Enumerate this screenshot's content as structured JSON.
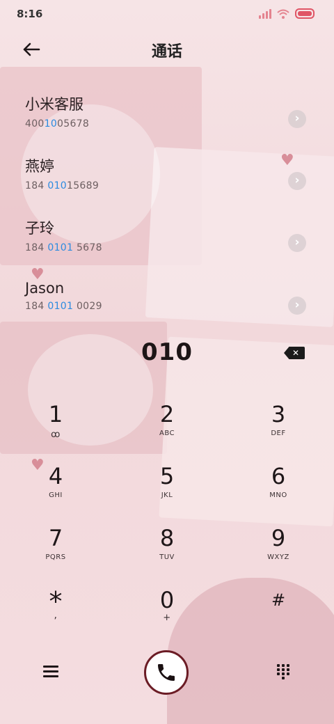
{
  "status_bar": {
    "time": "8:16"
  },
  "header": {
    "title": "通话"
  },
  "contacts": [
    {
      "name": "小米客服",
      "number_pre": "400",
      "number_hl": "10",
      "number_post": "05678"
    },
    {
      "name": "燕婷",
      "number_pre": "184 ",
      "number_hl": "010",
      "number_post": "15689"
    },
    {
      "name": "子玲",
      "number_pre": "184 ",
      "number_hl": "0101",
      "number_post": " 5678"
    },
    {
      "name": "Jason",
      "number_pre": "184 ",
      "number_hl": "0101",
      "number_post": " 0029"
    }
  ],
  "dial_input": "010",
  "keypad": [
    {
      "digit": "1",
      "letters": "ꝏ"
    },
    {
      "digit": "2",
      "letters": "ABC"
    },
    {
      "digit": "3",
      "letters": "DEF"
    },
    {
      "digit": "4",
      "letters": "GHI"
    },
    {
      "digit": "5",
      "letters": "JKL"
    },
    {
      "digit": "6",
      "letters": "MNO"
    },
    {
      "digit": "7",
      "letters": "PQRS"
    },
    {
      "digit": "8",
      "letters": "TUV"
    },
    {
      "digit": "9",
      "letters": "WXYZ"
    },
    {
      "digit": "*",
      "letters": ","
    },
    {
      "digit": "0",
      "letters": "+"
    },
    {
      "digit": "#",
      "letters": ""
    }
  ],
  "colors": {
    "highlight": "#2b8be0",
    "call_ring": "#6b1c25",
    "accent": "#e05566"
  },
  "icons": {
    "back": "arrow-left-icon",
    "delete": "backspace-icon",
    "menu": "menu-icon",
    "call": "phone-icon",
    "keypad_toggle": "dialpad-icon"
  }
}
